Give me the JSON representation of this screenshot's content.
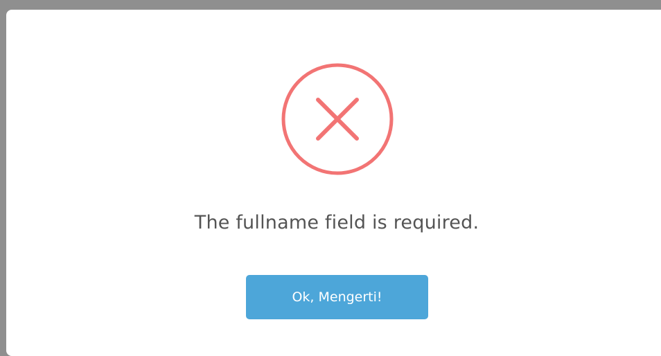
{
  "dialog": {
    "icon": "error-x-icon",
    "message": "The fullname field is required.",
    "confirm_label": "Ok, Mengerti!"
  },
  "colors": {
    "error_icon": "#f27474",
    "button_bg": "#4da6d9",
    "message_text": "#545454",
    "backdrop": "#8f8f8f"
  }
}
